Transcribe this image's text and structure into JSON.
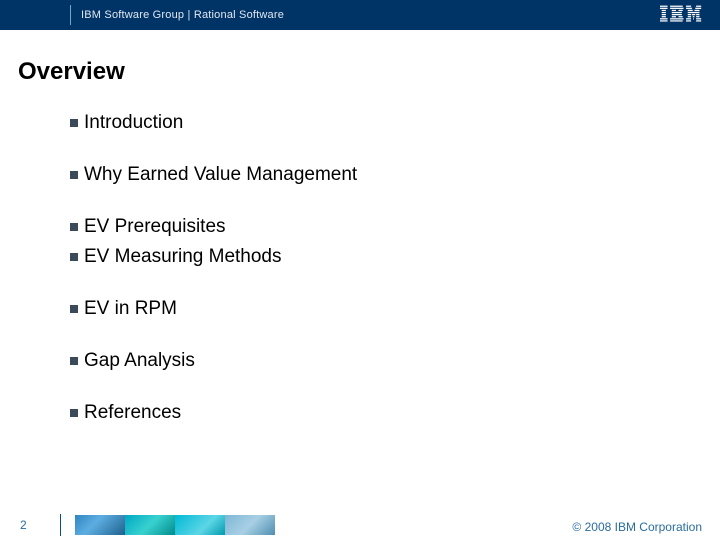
{
  "header": {
    "title": "IBM Software Group | Rational Software",
    "logo_name": "ibm-logo"
  },
  "page": {
    "title": "Overview",
    "number": "2"
  },
  "bullets": [
    "Introduction",
    "Why Earned Value Management",
    "EV Prerequisites",
    "EV Measuring Methods",
    "EV in RPM",
    "Gap Analysis",
    "References"
  ],
  "footer": {
    "copyright": "© 2008 IBM Corporation"
  }
}
